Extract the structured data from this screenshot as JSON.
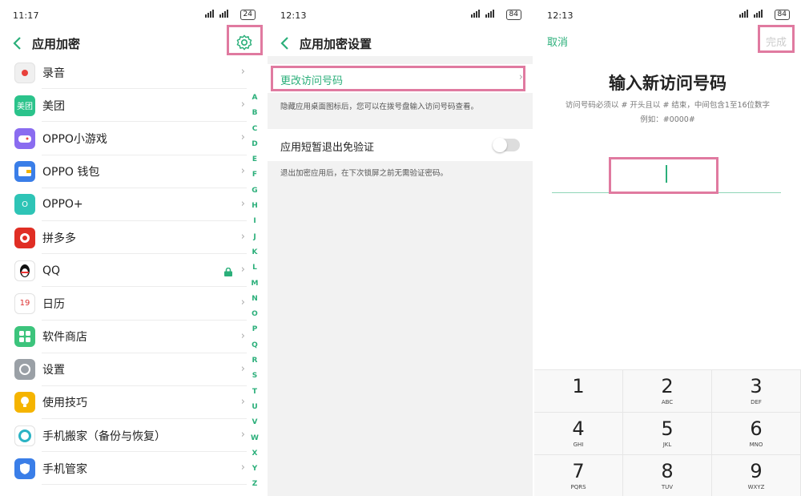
{
  "screen1": {
    "status_time": "11:17",
    "battery": "24",
    "title": "应用加密",
    "apps": [
      {
        "label": "录音",
        "icon": "record-icon",
        "color": "#f0f0f0"
      },
      {
        "label": "美团",
        "icon": "meituan-icon",
        "color": "#2bc38b",
        "icon_text": "美团"
      },
      {
        "label": "OPPO小游戏",
        "icon": "game-icon",
        "color": "#8a6cf0"
      },
      {
        "label": "OPPO 钱包",
        "icon": "wallet-icon",
        "color": "#3a7ee8"
      },
      {
        "label": "OPPO+",
        "icon": "oppo-plus-icon",
        "color": "#2ec4b6",
        "icon_text": "O"
      },
      {
        "label": "拼多多",
        "icon": "pinduoduo-icon",
        "color": "#e02e24"
      },
      {
        "label": "QQ",
        "icon": "qq-icon",
        "color": "#ffffff",
        "locked": true
      },
      {
        "label": "日历",
        "icon": "calendar-icon",
        "color": "#ffffff",
        "icon_text": "19"
      },
      {
        "label": "软件商店",
        "icon": "app-store-icon",
        "color": "#3cc47c"
      },
      {
        "label": "设置",
        "icon": "settings-app-icon",
        "color": "#9aa0a6"
      },
      {
        "label": "使用技巧",
        "icon": "tips-icon",
        "color": "#f5b400"
      },
      {
        "label": "手机搬家（备份与恢复）",
        "icon": "phone-clone-icon",
        "color": "#ffffff"
      },
      {
        "label": "手机管家",
        "icon": "phone-manager-icon",
        "color": "#3a7ee8"
      }
    ],
    "alphabet": [
      "A",
      "B",
      "C",
      "D",
      "E",
      "F",
      "G",
      "H",
      "I",
      "J",
      "K",
      "L",
      "M",
      "N",
      "O",
      "P",
      "Q",
      "R",
      "S",
      "T",
      "U",
      "V",
      "W",
      "X",
      "Y",
      "Z"
    ]
  },
  "screen2": {
    "status_time": "12:13",
    "battery": "84",
    "title": "应用加密设置",
    "change_code_label": "更改访问号码",
    "change_code_hint": "隐藏应用桌面图标后，您可以在拨号盘输入访问号码查看。",
    "quick_exit_label": "应用短暂退出免验证",
    "quick_exit_hint": "退出加密应用后，在下次锁屏之前无需验证密码。",
    "quick_exit_enabled": false
  },
  "screen3": {
    "status_time": "12:13",
    "battery": "84",
    "cancel_label": "取消",
    "done_label": "完成",
    "title": "输入新访问号码",
    "rule_text": "访问号码必须以 # 开头且以 # 结束，中间包含1至16位数字",
    "example_text": "例如：#0000#",
    "keys": [
      {
        "num": "1",
        "letters": ""
      },
      {
        "num": "2",
        "letters": "ABC"
      },
      {
        "num": "3",
        "letters": "DEF"
      },
      {
        "num": "4",
        "letters": "GHI"
      },
      {
        "num": "5",
        "letters": "JKL"
      },
      {
        "num": "6",
        "letters": "MNO"
      },
      {
        "num": "7",
        "letters": "PQRS"
      },
      {
        "num": "8",
        "letters": "TUV"
      },
      {
        "num": "9",
        "letters": "WXYZ"
      }
    ]
  },
  "colors": {
    "accent": "#2baf7a",
    "highlight": "#e07aa0"
  }
}
